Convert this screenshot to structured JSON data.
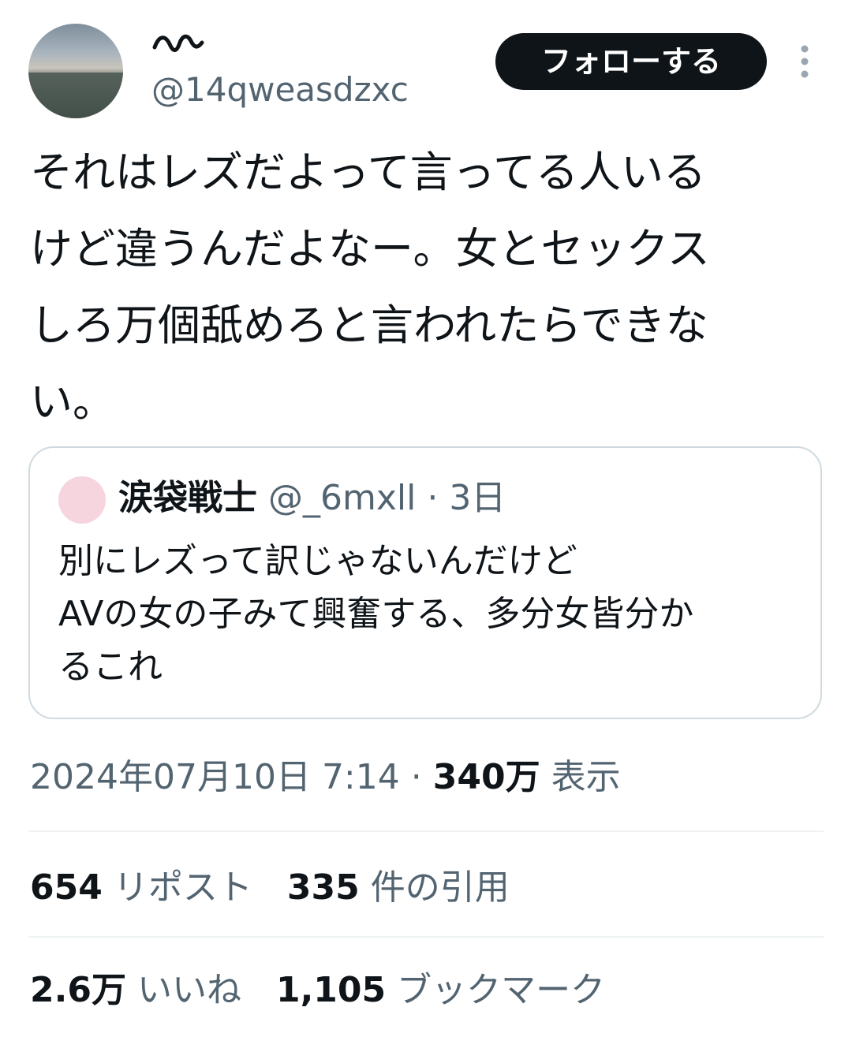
{
  "author": {
    "display_name": "〰",
    "handle": "@14qweasdzxc",
    "follow_label": "フォローする",
    "more_icon": "more-vertical-icon"
  },
  "tweet": {
    "text": "それはレズだよって言ってる人いる\nけど違うんだよなー。女とセックス\nしろ万個舐めろと言われたらできな\nい。"
  },
  "quote": {
    "name": "涙袋戦士",
    "handle": "@_6mxll",
    "separator": " · ",
    "age": "3日",
    "text": "別にレズって訳じゃないんだけど\nAVの女の子みて興奮する、多分女皆分か\nるこれ",
    "avatar_color": "#f6d5de"
  },
  "meta": {
    "timestamp": "2024年07月10日 7:14",
    "separator": " · ",
    "views": "340万",
    "views_label": "表示"
  },
  "stats_row1": {
    "reposts": "654",
    "reposts_label": "リポスト",
    "quotes": "335",
    "quotes_label": "件の引用"
  },
  "stats_row2": {
    "likes": "2.6万",
    "likes_label": "いいね",
    "bookmarks": "1,105",
    "bookmarks_label": "ブックマーク"
  },
  "colors": {
    "text": "#0f1419",
    "secondary": "#536471",
    "border": "#cfd9de",
    "divider": "#eff3f4",
    "button_bg": "#0f1419"
  }
}
